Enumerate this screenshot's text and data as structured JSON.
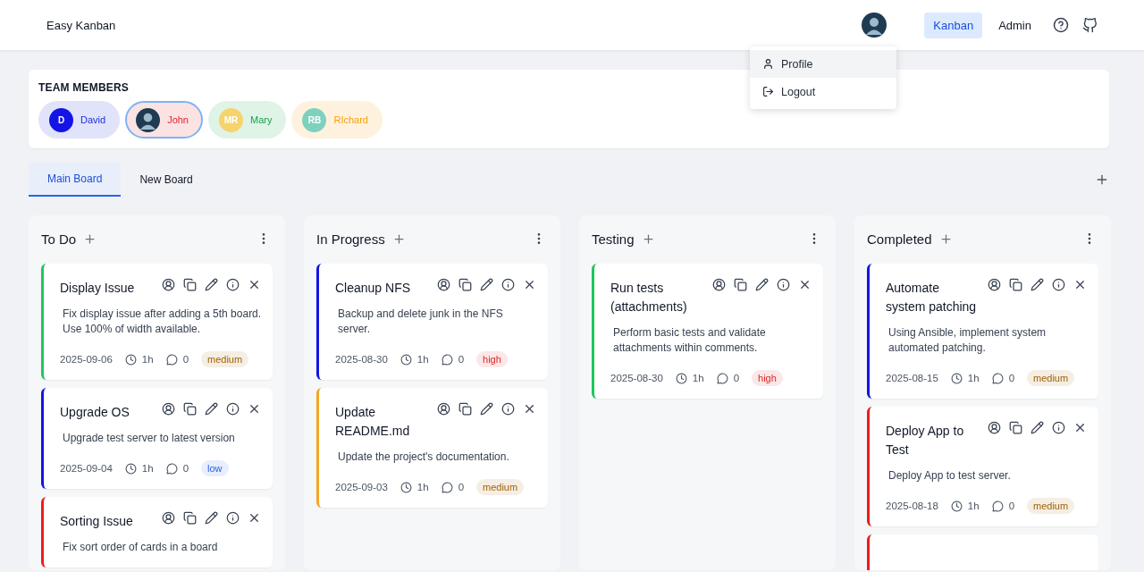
{
  "header": {
    "app_name": "Easy Kanban",
    "nav": [
      {
        "label": "Kanban",
        "selected": true
      },
      {
        "label": "Admin",
        "selected": false
      }
    ],
    "user_menu": [
      {
        "label": "Profile",
        "kind": "profile",
        "hovered": true
      },
      {
        "label": "Logout",
        "kind": "logout",
        "hovered": false
      }
    ]
  },
  "team": {
    "title": "TEAM MEMBERS",
    "members": [
      {
        "name": "David",
        "kind": "initials",
        "avatar": {
          "initials": "D",
          "color": "#1414e6"
        },
        "color": "#1d2fd6",
        "selected": false
      },
      {
        "name": "John",
        "kind": "photo",
        "color": "#e0242f",
        "selected": true
      },
      {
        "name": "Mary",
        "kind": "initials",
        "avatar": {
          "initials": "MR",
          "color": "#f6d36b"
        },
        "color": "#16a34a",
        "selected": false
      },
      {
        "name": "RIchard",
        "kind": "initials",
        "avatar": {
          "initials": "RB",
          "color": "#7fd1bf"
        },
        "color": "#f59e0b",
        "selected": false
      }
    ]
  },
  "boards": [
    {
      "label": "Main Board",
      "selected": true
    },
    {
      "label": "New Board",
      "selected": false
    }
  ],
  "columns": [
    {
      "title": "To Do",
      "cards": [
        {
          "title": "Display Issue",
          "description": "Fix display issue after adding a 5th board.  Use 100% of width available.",
          "date": "2025-09-06",
          "effort": "1h",
          "comments": "0",
          "priority": {
            "label": "medium",
            "color": "#a16207"
          },
          "color": "#22c55e"
        },
        {
          "title": "Upgrade OS",
          "description": "Upgrade test server to latest version",
          "date": "2025-09-04",
          "effort": "1h",
          "comments": "0",
          "priority": {
            "label": "low",
            "color": "#2563eb"
          },
          "color": "#1414e6"
        },
        {
          "title": "Sorting Issue",
          "description": "Fix sort order of cards in a board",
          "color": "#ef1c1c"
        }
      ]
    },
    {
      "title": "In Progress",
      "cards": [
        {
          "title": "Cleanup NFS",
          "description": "Backup and delete junk in the NFS server.",
          "date": "2025-08-30",
          "effort": "1h",
          "comments": "0",
          "priority": {
            "label": "high",
            "color": "#dc2626"
          },
          "color": "#1414e6"
        },
        {
          "title": "Update README.md",
          "description": "Update the project's documentation.",
          "date": "2025-09-03",
          "effort": "1h",
          "comments": "0",
          "priority": {
            "label": "medium",
            "color": "#a16207"
          },
          "color": "#f5a623"
        }
      ]
    },
    {
      "title": "Testing",
      "cards": [
        {
          "title": "Run tests (attachments)",
          "description": "Perform basic tests and validate attachments within comments.",
          "date": "2025-08-30",
          "effort": "1h",
          "comments": "0",
          "priority": {
            "label": "high",
            "color": "#dc2626"
          },
          "color": "#22c55e"
        }
      ]
    },
    {
      "title": "Completed",
      "cards": [
        {
          "title": "Automate system patching",
          "description": "Using Ansible, implement system automated patching.",
          "date": "2025-08-15",
          "effort": "1h",
          "comments": "0",
          "priority": {
            "label": "medium",
            "color": "#a16207"
          },
          "color": "#1414e6"
        },
        {
          "title": "Deploy App to Test",
          "description": "Deploy App to test server.",
          "date": "2025-08-18",
          "effort": "1h",
          "comments": "0",
          "priority": {
            "label": "medium",
            "color": "#a16207"
          },
          "color": "#ef1c1c"
        },
        {
          "color": "#ef1c1c"
        }
      ]
    }
  ]
}
